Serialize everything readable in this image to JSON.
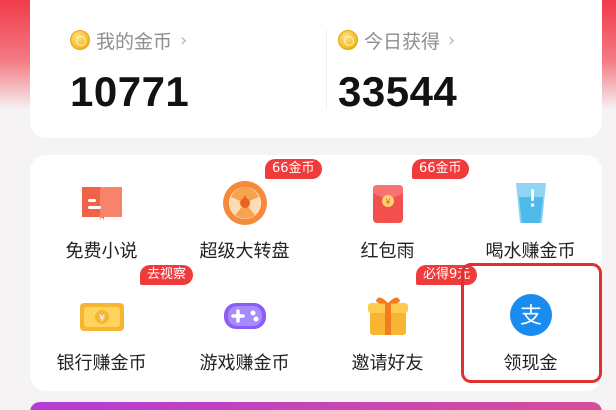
{
  "coins": {
    "my_coins_label": "我的金币",
    "my_coins_value": "10771",
    "today_label": "今日获得",
    "today_value": "33544"
  },
  "tasks": [
    {
      "label": "免费小说",
      "icon": "book-icon",
      "badge": ""
    },
    {
      "label": "超级大转盘",
      "icon": "wheel-icon",
      "badge": "66金币"
    },
    {
      "label": "红包雨",
      "icon": "red-envelope-icon",
      "badge": "66金币"
    },
    {
      "label": "喝水赚金币",
      "icon": "water-glass-icon",
      "badge": ""
    },
    {
      "label": "银行赚金币",
      "icon": "coin-card-icon",
      "badge": "去视察"
    },
    {
      "label": "游戏赚金币",
      "icon": "gamepad-icon",
      "badge": ""
    },
    {
      "label": "邀请好友",
      "icon": "gift-icon",
      "badge": "必得9元"
    },
    {
      "label": "领现金",
      "icon": "alipay-icon",
      "badge": ""
    }
  ],
  "colors": {
    "accent": "#ef3b4a",
    "badge": "#ef3b3b",
    "highlight": "#e03030"
  }
}
